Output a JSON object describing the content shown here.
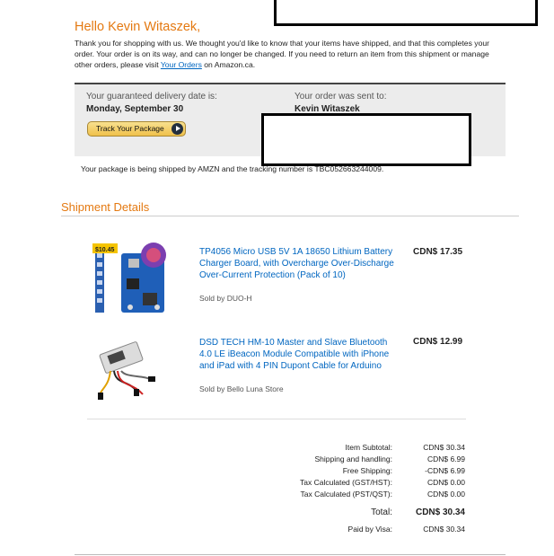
{
  "greeting": "Hello Kevin Witaszek,",
  "intro": {
    "text_before": "Thank you for shopping with us. We thought you'd like to know that your items have shipped, and that this completes your order. Your order is on its way, and can no longer be changed. If you need to return an item from this shipment or manage other orders, please visit ",
    "link": "Your Orders",
    "text_after": " on Amazon.ca."
  },
  "delivery": {
    "date_label": "Your guaranteed delivery date is:",
    "date_value": "Monday, September 30",
    "sent_label": "Your order was sent to:",
    "sent_value": "Kevin Witaszek",
    "track_button": "Track Your Package"
  },
  "shipping_note": "Your package is being shipped by AMZN and the tracking number is TBC052663244009.",
  "section_title": "Shipment Details",
  "items": [
    {
      "title": "TP4056 Micro USB 5V 1A 18650 Lithium Battery Charger Board, with Overcharge Over-Discharge Over-Current Protection (Pack of 10)",
      "seller": "Sold by DUO-H",
      "price": "CDN$ 17.35",
      "image_tag": "$10.45",
      "image_icon": "charger-board-image"
    },
    {
      "title": "DSD TECH HM-10 Master and Slave Bluetooth 4.0 LE iBeacon Module Compatible with iPhone and iPad with 4 PIN Dupont Cable for Arduino",
      "seller": "Sold by Bello Luna Store",
      "price": "CDN$ 12.99",
      "image_icon": "bluetooth-module-image"
    }
  ],
  "summary": {
    "rows": [
      {
        "label": "Item Subtotal:",
        "value": "CDN$ 30.34"
      },
      {
        "label": "Shipping and handling:",
        "value": "CDN$ 6.99"
      },
      {
        "label": "Free Shipping:",
        "value": "-CDN$ 6.99"
      },
      {
        "label": "Tax Calculated (GST/HST):",
        "value": "CDN$ 0.00"
      },
      {
        "label": "Tax Calculated (PST/QST):",
        "value": "CDN$ 0.00"
      }
    ],
    "total_label": "Total:",
    "total_value": "CDN$ 30.34",
    "paid_label": "Paid by Visa:",
    "paid_value": "CDN$ 30.34"
  },
  "colors": {
    "accent": "#e47911",
    "link": "#0066c0",
    "box": "#ececec"
  }
}
